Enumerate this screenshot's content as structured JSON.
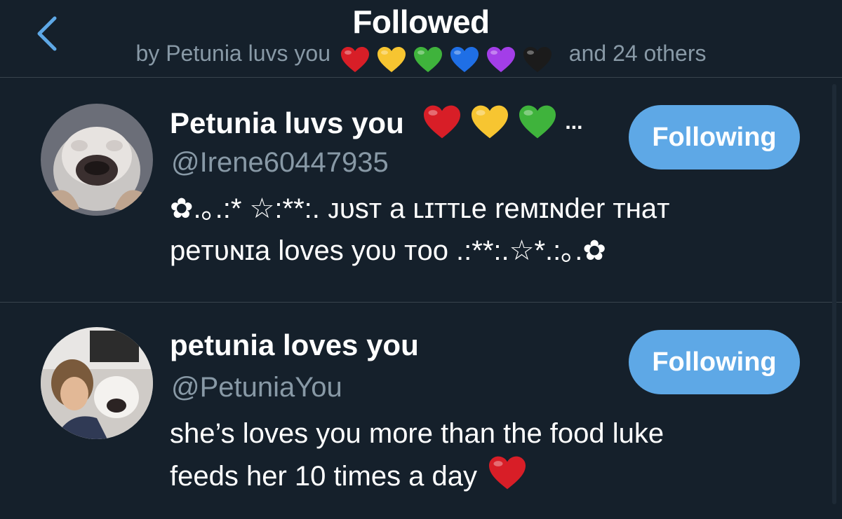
{
  "header": {
    "back_icon": "chevron-left-icon",
    "title": "Followed",
    "subtitle_prefix": "by Petunia luvs you",
    "subtitle_suffix": "and 24 others",
    "heart_colors": [
      "#d81e27",
      "#f7c531",
      "#3fb33c",
      "#1f6fe6",
      "#a33ee8",
      "#1b1b1b"
    ]
  },
  "users": [
    {
      "name": "Petunia luvs you",
      "name_hearts": [
        "#d81e27",
        "#f7c531",
        "#3fb33c"
      ],
      "name_ellipsis": "...",
      "handle": "@Irene60447935",
      "bio_lines": [
        "✿.｡.:* ☆:**:. ᴊᴜsᴛ a ʟɪᴛᴛʟe reᴍɪɴder ᴛʜaᴛ",
        "peᴛᴜɴɪa loves yoᴜ ᴛoo .:**:.☆*.:｡.✿"
      ],
      "button_label": "Following"
    },
    {
      "name": "petunia loves you",
      "handle": "@PetuniaYou",
      "bio_lines": [
        "she’s loves you more than the food luke",
        "feeds her 10 times a day"
      ],
      "bio_heart_color": "#d81e27",
      "button_label": "Following"
    }
  ],
  "colors": {
    "background": "#15202b",
    "accent": "#5ea8e6",
    "secondary_text": "#8899a6",
    "divider": "#38444d"
  }
}
